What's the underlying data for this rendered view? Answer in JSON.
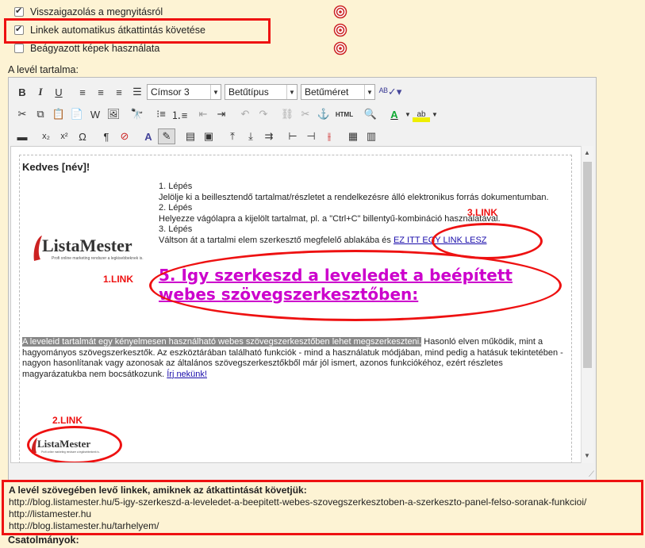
{
  "options": [
    {
      "label": "Visszaigazolás a megnyitásról",
      "checked": true
    },
    {
      "label": "Linkek automatikus átkattintás követése",
      "checked": true
    },
    {
      "label": "Beágyazott képek használata",
      "checked": false
    }
  ],
  "content_label": "A levél tartalma:",
  "toolbar": {
    "format_value": "Címsor 3",
    "font_value": "Betűtípus",
    "size_value": "Betűméret"
  },
  "editor": {
    "greeting": "Kedves [név]!",
    "step1_title": "1. Lépés",
    "step1_text": "Jelölje ki a beillesztendő tartalmat/részletet a rendelkezésre álló elektronikus forrás dokumentumban.",
    "step2_title": "2. Lépés",
    "step2_text": "Helyezze vágólapra a kijelölt tartalmat, pl. a \"Ctrl+C\" billentyű-kombináció használatával.",
    "step3_title": "3. Lépés",
    "step3_text": "Váltson át a tartalmi elem szerkesztő megfelelő ablakába és ",
    "step3_link": "EZ ITT EGY LINK LESZ",
    "headline": "5. Így szerkeszd a leveledet a beépített webes szövegszerkesztőben:",
    "para_highlight": "A leveleid tartalmát egy kényelmesen használható webes szövegszerkesztőben lehet megszerkeszteni.",
    "para_text": " Hasonló elven működik, mint a hagyományos szövegszerkesztők. Az eszköztárában található funkciók - mind a használatuk módjában, mind pedig a hatásuk tekintetében - nagyon hasonlítanak vagy azonosak az általános szövegszerkesztőkből már jól ismert, azonos funkciókéhoz, ezért részletes magyarázatukba nem bocsátkozunk. ",
    "para_link": "Írj nekünk!",
    "logo_text_main": "ListaMester",
    "logo_tagline": "Profi online marketing rendszer a legkisebbeknek is."
  },
  "annotations": {
    "link1": "1.LINK",
    "link2": "2.LINK",
    "link3": "3.LINK"
  },
  "tracked_links": {
    "title": "A levél szövegében levő linkek, amiknek az átkattintását követjük:",
    "urls": [
      "http://blog.listamester.hu/5-igy-szerkeszd-a-leveledet-a-beepitett-webes-szovegszerkesztoben-a-szerkeszto-panel-felso-soranak-funkcioi/",
      "http://listamester.hu",
      "http://blog.listamester.hu/tarhelyem/"
    ]
  },
  "attachments_label": "Csatolmányok:",
  "colors": {
    "annotation": "#ee1111",
    "headline": "#cc00cc",
    "background": "#fdf3d4"
  }
}
